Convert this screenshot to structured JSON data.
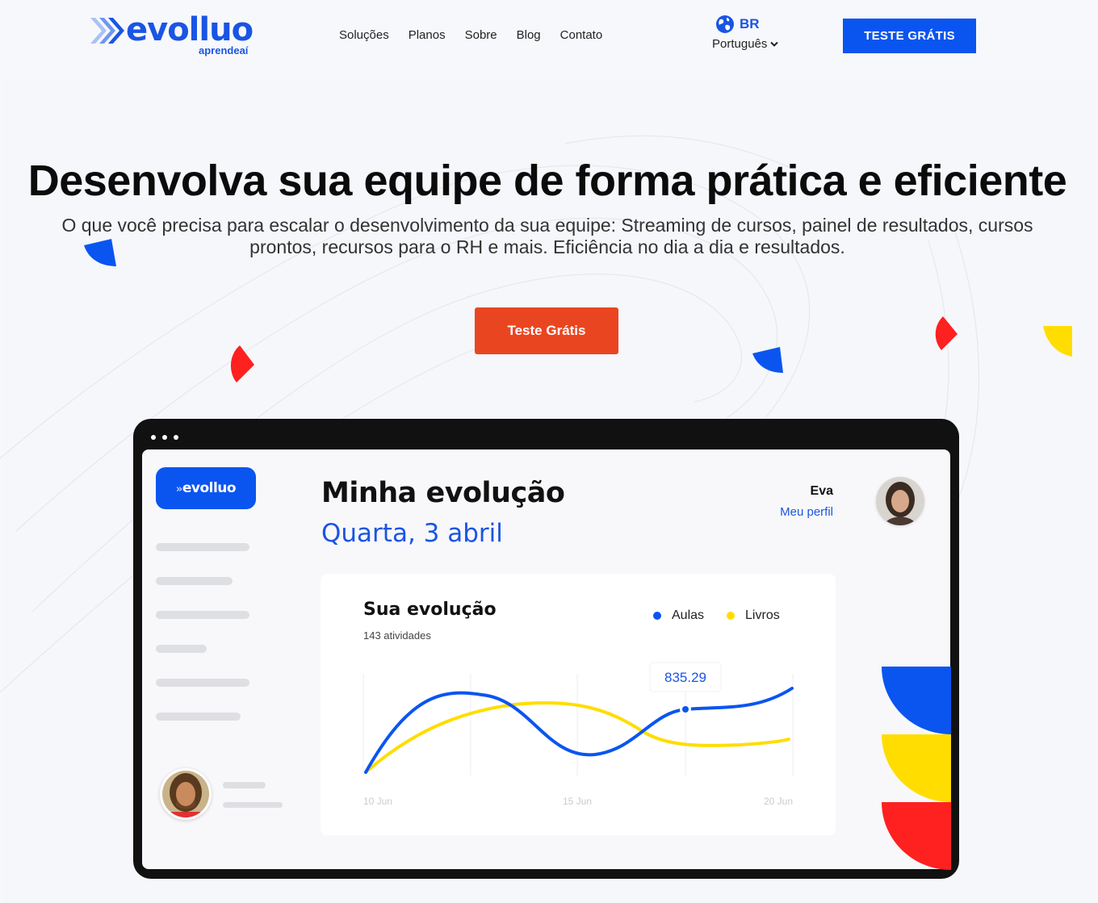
{
  "header": {
    "logo_word": "evolluo",
    "logo_sub": "aprendeaí",
    "nav": [
      "Soluções",
      "Planos",
      "Sobre",
      "Blog",
      "Contato"
    ],
    "lang_code": "BR",
    "lang_label": "Português",
    "cta": "TESTE GRÁTIS"
  },
  "hero": {
    "title": "Desenvolva sua equipe de forma prática e eficiente",
    "subtitle": "O que você precisa para escalar o desenvolvimento da sua equipe: Streaming de cursos, painel de resultados, cursos prontos, recursos para o RH e mais. Eficiência no dia a dia e resultados.",
    "cta": "Teste Grátis"
  },
  "mockup": {
    "logo": "evolluo",
    "page_title": "Minha evolução",
    "date": "Quarta, 3 abril",
    "profile_name": "Eva",
    "profile_link": "Meu perfil",
    "card_title": "Sua evolução",
    "card_sub": "143 atividades",
    "tooltip_value": "835.29"
  },
  "colors": {
    "primary": "#0a55f0",
    "accent_orange": "#ea4521",
    "yellow": "#ffdd00",
    "red": "#ff2020"
  },
  "chart_data": {
    "type": "line",
    "x_ticks": [
      "10 Jun",
      "15 Jun",
      "20 Jun"
    ],
    "series": [
      {
        "name": "Aulas",
        "color": "#0a55f0"
      },
      {
        "name": "Livros",
        "color": "#ffdd00"
      }
    ],
    "highlight": {
      "series": "Aulas",
      "value": "835.29"
    },
    "grid": true,
    "legend": "top-right"
  }
}
